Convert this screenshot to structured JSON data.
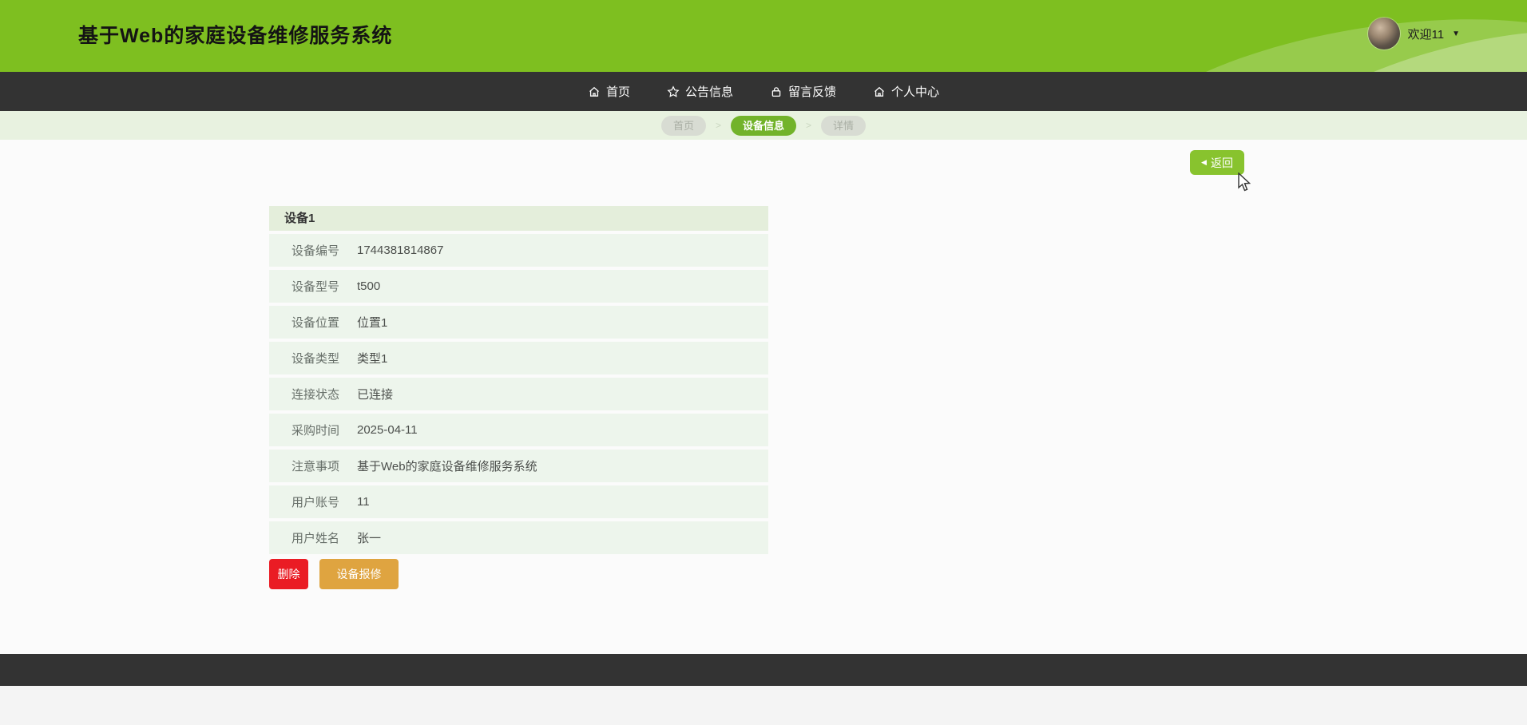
{
  "header": {
    "title": "基于Web的家庭设备维修服务系统",
    "welcome": "欢迎11",
    "dropdown_arrow": "▼"
  },
  "nav": {
    "items": [
      {
        "label": "首页",
        "icon": "home-icon"
      },
      {
        "label": "公告信息",
        "icon": "star-icon"
      },
      {
        "label": "留言反馈",
        "icon": "lock-icon"
      },
      {
        "label": "个人中心",
        "icon": "home-icon"
      }
    ]
  },
  "breadcrumb": {
    "separator": ">",
    "items": [
      {
        "label": "首页",
        "active": false
      },
      {
        "label": "设备信息",
        "active": true
      },
      {
        "label": "详情",
        "active": false
      }
    ]
  },
  "toolbar": {
    "back_icon": "◀",
    "back_label": "返回"
  },
  "detail": {
    "title": "设备1",
    "rows": [
      {
        "label": "设备编号",
        "value": "1744381814867"
      },
      {
        "label": "设备型号",
        "value": "t500"
      },
      {
        "label": "设备位置",
        "value": "位置1"
      },
      {
        "label": "设备类型",
        "value": "类型1"
      },
      {
        "label": "连接状态",
        "value": "已连接"
      },
      {
        "label": "采购时间",
        "value": "2025-04-11"
      },
      {
        "label": "注意事项",
        "value": "基于Web的家庭设备维修服务系统"
      },
      {
        "label": "用户账号",
        "value": "11"
      },
      {
        "label": "用户姓名",
        "value": "张一"
      }
    ],
    "actions": {
      "delete_label": "删除",
      "repair_label": "设备报修"
    }
  },
  "colors": {
    "header_green": "#7ebf20",
    "nav_dark": "#333333",
    "breadcrumb_band": "#e8f2e0",
    "active_pill_green": "#72b32a",
    "back_button_green": "#88c32e",
    "table_header_bg": "#e4eedb",
    "table_row_bg": "#edf5ec",
    "delete_red": "#ea1c24",
    "repair_orange": "#dfa440"
  }
}
